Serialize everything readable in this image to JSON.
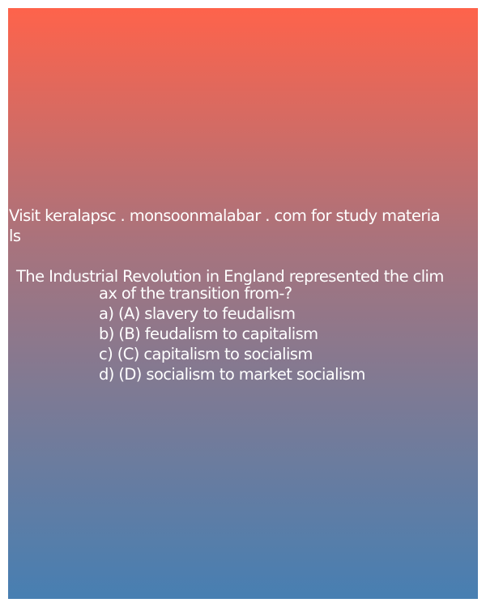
{
  "promo": {
    "line1": "Visit keralapsc . monsoonmalabar . com for study materia",
    "line2": "ls"
  },
  "question": {
    "line1": "The Industrial Revolution in England represented the clim",
    "line2": "ax of the transition from-?"
  },
  "options": [
    "a) (A) slavery to feudalism",
    "b) (B) feudalism to capitalism",
    "c) (C) capitalism to socialism",
    "d) (D) socialism to market socialism"
  ],
  "colors": {
    "gradient_top": "#fe634b",
    "gradient_bottom": "#477fb2",
    "text": "#ffffff"
  }
}
